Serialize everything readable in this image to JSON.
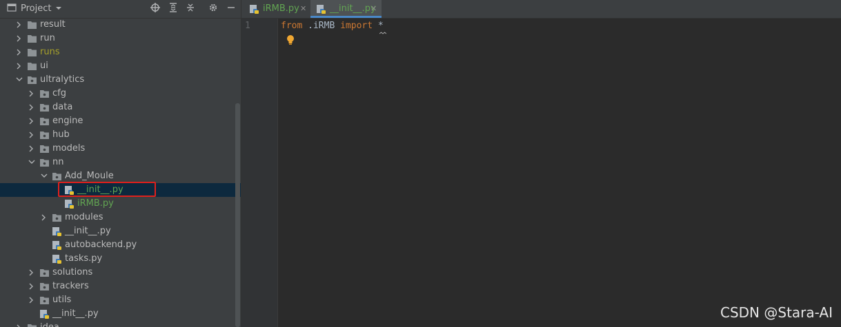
{
  "project_panel": {
    "title": "Project",
    "tree": [
      {
        "label": "result",
        "type": "folder",
        "depth": 0,
        "expanded": false
      },
      {
        "label": "run",
        "type": "folder",
        "depth": 0,
        "expanded": false
      },
      {
        "label": "runs",
        "type": "folder",
        "depth": 0,
        "expanded": false,
        "color": "yellow"
      },
      {
        "label": "ui",
        "type": "folder",
        "depth": 0,
        "expanded": false
      },
      {
        "label": "ultralytics",
        "type": "package",
        "depth": 0,
        "expanded": true
      },
      {
        "label": "cfg",
        "type": "package",
        "depth": 1,
        "expanded": false
      },
      {
        "label": "data",
        "type": "package",
        "depth": 1,
        "expanded": false
      },
      {
        "label": "engine",
        "type": "package",
        "depth": 1,
        "expanded": false
      },
      {
        "label": "hub",
        "type": "package",
        "depth": 1,
        "expanded": false
      },
      {
        "label": "models",
        "type": "package",
        "depth": 1,
        "expanded": false
      },
      {
        "label": "nn",
        "type": "package",
        "depth": 1,
        "expanded": true
      },
      {
        "label": "Add_Moule",
        "type": "package",
        "depth": 2,
        "expanded": true
      },
      {
        "label": "__init__.py",
        "type": "pyfile",
        "depth": 3,
        "selected": true,
        "color": "green"
      },
      {
        "label": "iRMB.py",
        "type": "pyfile",
        "depth": 3,
        "color": "green"
      },
      {
        "label": "modules",
        "type": "package",
        "depth": 2,
        "expanded": false
      },
      {
        "label": "__init__.py",
        "type": "pyfile",
        "depth": 2
      },
      {
        "label": "autobackend.py",
        "type": "pyfile",
        "depth": 2
      },
      {
        "label": "tasks.py",
        "type": "pyfile",
        "depth": 2
      },
      {
        "label": "solutions",
        "type": "package",
        "depth": 1,
        "expanded": false
      },
      {
        "label": "trackers",
        "type": "package",
        "depth": 1,
        "expanded": false
      },
      {
        "label": "utils",
        "type": "package",
        "depth": 1,
        "expanded": false
      },
      {
        "label": "__init__.py",
        "type": "pyfile",
        "depth": 1
      },
      {
        "label": "idea",
        "type": "folder",
        "depth": 0,
        "expanded": false
      }
    ]
  },
  "tabs": [
    {
      "label": "iRMB.py",
      "active": false
    },
    {
      "label": "__init__.py",
      "active": true
    }
  ],
  "editor": {
    "line_number": "1",
    "code": {
      "kw1": "from",
      "module": " .iRMB ",
      "kw2": "import",
      "star": " *"
    }
  },
  "watermark": "CSDN @Stara-AI",
  "colors": {
    "selection": "#0d293e",
    "highlight_box": "#e0201c",
    "keyword": "#cc7832",
    "python_green": "#62a552"
  }
}
